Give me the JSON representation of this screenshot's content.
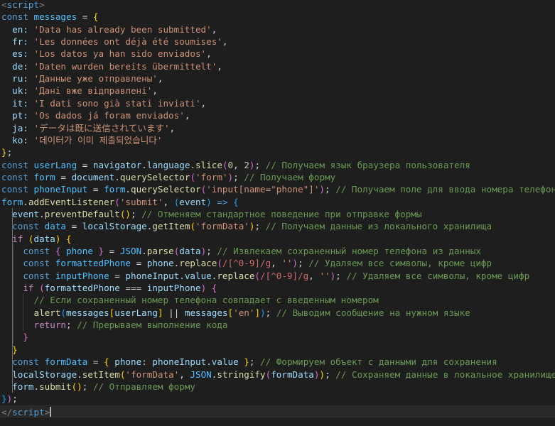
{
  "editor": {
    "language": "javascript",
    "colors": {
      "background": "#1e1e1e",
      "tag": "#569cd6",
      "keyword": "#569cd6",
      "control": "#c586c0",
      "variable": "#9cdcfe",
      "constant": "#4fc1ff",
      "function": "#dcdcaa",
      "string": "#ce9178",
      "number": "#b5cea8",
      "comment": "#6a9955",
      "regex": "#d16969",
      "bracket_gold": "#ffd700",
      "bracket_purple": "#da70d6",
      "bracket_blue": "#179fff",
      "text": "#d4d4d4",
      "punct": "#808080"
    },
    "lines": [
      [
        [
          "<",
          "punct"
        ],
        [
          "script",
          "tag"
        ],
        [
          ">",
          "punct"
        ]
      ],
      [
        [
          "const ",
          "keyword"
        ],
        [
          "messages",
          "constant"
        ],
        [
          " = ",
          "text"
        ],
        [
          "{",
          "bracket_gold"
        ]
      ],
      [
        [
          "  en: ",
          "variable"
        ],
        [
          "'Data has already been submitted'",
          "string"
        ],
        [
          ",",
          "text"
        ]
      ],
      [
        [
          "  fr: ",
          "variable"
        ],
        [
          "'Les données ont déjà été soumises'",
          "string"
        ],
        [
          ",",
          "text"
        ]
      ],
      [
        [
          "  es: ",
          "variable"
        ],
        [
          "'Los datos ya han sido enviados'",
          "string"
        ],
        [
          ",",
          "text"
        ]
      ],
      [
        [
          "  de: ",
          "variable"
        ],
        [
          "'Daten wurden bereits übermittelt'",
          "string"
        ],
        [
          ",",
          "text"
        ]
      ],
      [
        [
          "  ru: ",
          "variable"
        ],
        [
          "'Данные уже отправлены'",
          "string"
        ],
        [
          ",",
          "text"
        ]
      ],
      [
        [
          "  uk: ",
          "variable"
        ],
        [
          "'Дані вже відправлені'",
          "string"
        ],
        [
          ",",
          "text"
        ]
      ],
      [
        [
          "  it: ",
          "variable"
        ],
        [
          "'I dati sono già stati inviati'",
          "string"
        ],
        [
          ",",
          "text"
        ]
      ],
      [
        [
          "  pt: ",
          "variable"
        ],
        [
          "'Os dados já foram enviados'",
          "string"
        ],
        [
          ",",
          "text"
        ]
      ],
      [
        [
          "  ja: ",
          "variable"
        ],
        [
          "'データは既に送信されています'",
          "string"
        ],
        [
          ",",
          "text"
        ]
      ],
      [
        [
          "  ko: ",
          "variable"
        ],
        [
          "'데이터가 이미 제출되었습니다'",
          "string"
        ]
      ],
      [
        [
          "}",
          "bracket_gold"
        ],
        [
          ";",
          "text"
        ]
      ],
      [
        [
          "const ",
          "keyword"
        ],
        [
          "userLang",
          "constant"
        ],
        [
          " = ",
          "text"
        ],
        [
          "navigator",
          "variable"
        ],
        [
          ".",
          "text"
        ],
        [
          "language",
          "variable"
        ],
        [
          ".",
          "text"
        ],
        [
          "slice",
          "function"
        ],
        [
          "(",
          "bracket_purple"
        ],
        [
          "0",
          "number"
        ],
        [
          ", ",
          "text"
        ],
        [
          "2",
          "number"
        ],
        [
          ")",
          "bracket_purple"
        ],
        [
          "; ",
          "text"
        ],
        [
          "// Получаем язык браузера пользователя",
          "comment"
        ]
      ],
      [
        [
          "const ",
          "keyword"
        ],
        [
          "form",
          "constant"
        ],
        [
          " = ",
          "text"
        ],
        [
          "document",
          "variable"
        ],
        [
          ".",
          "text"
        ],
        [
          "querySelector",
          "function"
        ],
        [
          "(",
          "bracket_purple"
        ],
        [
          "'form'",
          "string"
        ],
        [
          ")",
          "bracket_purple"
        ],
        [
          "; ",
          "text"
        ],
        [
          "// Получаем форму",
          "comment"
        ]
      ],
      [
        [
          "const ",
          "keyword"
        ],
        [
          "phoneInput",
          "constant"
        ],
        [
          " = ",
          "text"
        ],
        [
          "form",
          "constant"
        ],
        [
          ".",
          "text"
        ],
        [
          "querySelector",
          "function"
        ],
        [
          "(",
          "bracket_purple"
        ],
        [
          "'input[name=\"phone\"]'",
          "string"
        ],
        [
          ")",
          "bracket_purple"
        ],
        [
          "; ",
          "text"
        ],
        [
          "// Получаем поле для ввода номера телефона",
          "comment"
        ]
      ],
      [
        [
          "form",
          "constant"
        ],
        [
          ".",
          "text"
        ],
        [
          "addEventListener",
          "function"
        ],
        [
          "(",
          "bracket_purple"
        ],
        [
          "'submit'",
          "string"
        ],
        [
          ", ",
          "text"
        ],
        [
          "(",
          "bracket_blue"
        ],
        [
          "event",
          "variable"
        ],
        [
          ")",
          "bracket_blue"
        ],
        [
          " => ",
          "keyword"
        ],
        [
          "{",
          "bracket_blue"
        ]
      ],
      [
        [
          "  event",
          "variable"
        ],
        [
          ".",
          "text"
        ],
        [
          "preventDefault",
          "function"
        ],
        [
          "()",
          "bracket_gold"
        ],
        [
          "; ",
          "text"
        ],
        [
          "// Отменяем стандартное поведение при отправке формы",
          "comment"
        ]
      ],
      [
        [
          "  const ",
          "keyword"
        ],
        [
          "data",
          "constant"
        ],
        [
          " = ",
          "text"
        ],
        [
          "localStorage",
          "variable"
        ],
        [
          ".",
          "text"
        ],
        [
          "getItem",
          "function"
        ],
        [
          "(",
          "bracket_gold"
        ],
        [
          "'formData'",
          "string"
        ],
        [
          ")",
          "bracket_gold"
        ],
        [
          "; ",
          "text"
        ],
        [
          "// Получаем данные из локального хранилища",
          "comment"
        ]
      ],
      [
        [
          "  if ",
          "control"
        ],
        [
          "(",
          "bracket_gold"
        ],
        [
          "data",
          "variable"
        ],
        [
          ") ",
          "bracket_gold"
        ],
        [
          "{",
          "bracket_gold"
        ]
      ],
      [
        [
          "    const ",
          "keyword"
        ],
        [
          "{ ",
          "bracket_purple"
        ],
        [
          "phone",
          "constant"
        ],
        [
          " }",
          "bracket_purple"
        ],
        [
          " = ",
          "text"
        ],
        [
          "JSON",
          "constant"
        ],
        [
          ".",
          "text"
        ],
        [
          "parse",
          "function"
        ],
        [
          "(",
          "bracket_purple"
        ],
        [
          "data",
          "variable"
        ],
        [
          ")",
          "bracket_purple"
        ],
        [
          "; ",
          "text"
        ],
        [
          "// Извлекаем сохраненный номер телефона из данных",
          "comment"
        ]
      ],
      [
        [
          "    const ",
          "keyword"
        ],
        [
          "formattedPhone",
          "constant"
        ],
        [
          " = ",
          "text"
        ],
        [
          "phone",
          "variable"
        ],
        [
          ".",
          "text"
        ],
        [
          "replace",
          "function"
        ],
        [
          "(",
          "bracket_purple"
        ],
        [
          "/[^0-9]/g",
          "regex"
        ],
        [
          ", ",
          "text"
        ],
        [
          "''",
          "string"
        ],
        [
          ")",
          "bracket_purple"
        ],
        [
          "; ",
          "text"
        ],
        [
          "// Удаляем все символы, кроме цифр",
          "comment"
        ]
      ],
      [
        [
          "    const ",
          "keyword"
        ],
        [
          "inputPhone",
          "constant"
        ],
        [
          " = ",
          "text"
        ],
        [
          "phoneInput",
          "variable"
        ],
        [
          ".",
          "text"
        ],
        [
          "value",
          "variable"
        ],
        [
          ".",
          "text"
        ],
        [
          "replace",
          "function"
        ],
        [
          "(",
          "bracket_purple"
        ],
        [
          "/[^0-9]/g",
          "regex"
        ],
        [
          ", ",
          "text"
        ],
        [
          "''",
          "string"
        ],
        [
          ")",
          "bracket_purple"
        ],
        [
          "; ",
          "text"
        ],
        [
          "// Удаляем все символы, кроме цифр",
          "comment"
        ]
      ],
      [
        [
          "    if ",
          "control"
        ],
        [
          "(",
          "bracket_purple"
        ],
        [
          "formattedPhone",
          "variable"
        ],
        [
          " === ",
          "text"
        ],
        [
          "inputPhone",
          "variable"
        ],
        [
          ")",
          "bracket_purple"
        ],
        [
          " ",
          "text"
        ],
        [
          "{",
          "bracket_purple"
        ]
      ],
      [
        [
          "      // Если сохраненный номер телефона совпадает с введенным номером",
          "comment"
        ]
      ],
      [
        [
          "      alert",
          "function"
        ],
        [
          "(",
          "bracket_blue"
        ],
        [
          "messages",
          "variable"
        ],
        [
          "[",
          "bracket_gold"
        ],
        [
          "userLang",
          "variable"
        ],
        [
          "]",
          "bracket_gold"
        ],
        [
          " || ",
          "text"
        ],
        [
          "messages",
          "variable"
        ],
        [
          "[",
          "bracket_gold"
        ],
        [
          "'en'",
          "string"
        ],
        [
          "]",
          "bracket_gold"
        ],
        [
          ")",
          "bracket_blue"
        ],
        [
          "; ",
          "text"
        ],
        [
          "// Выводим сообщение на нужном языке",
          "comment"
        ]
      ],
      [
        [
          "      return",
          "control"
        ],
        [
          "; ",
          "text"
        ],
        [
          "// Прерываем выполнение кода",
          "comment"
        ]
      ],
      [
        [
          "    }",
          "bracket_purple"
        ]
      ],
      [
        [
          "  }",
          "bracket_gold"
        ]
      ],
      [
        [
          "  const ",
          "keyword"
        ],
        [
          "formData",
          "constant"
        ],
        [
          " = ",
          "text"
        ],
        [
          "{ ",
          "bracket_gold"
        ],
        [
          "phone",
          "variable"
        ],
        [
          ": ",
          "text"
        ],
        [
          "phoneInput",
          "variable"
        ],
        [
          ".",
          "text"
        ],
        [
          "value",
          "variable"
        ],
        [
          " }",
          "bracket_gold"
        ],
        [
          "; ",
          "text"
        ],
        [
          "// Формируем объект с данными для сохранения",
          "comment"
        ]
      ],
      [
        [
          "  localStorage",
          "variable"
        ],
        [
          ".",
          "text"
        ],
        [
          "setItem",
          "function"
        ],
        [
          "(",
          "bracket_gold"
        ],
        [
          "'formData'",
          "string"
        ],
        [
          ", ",
          "text"
        ],
        [
          "JSON",
          "constant"
        ],
        [
          ".",
          "text"
        ],
        [
          "stringify",
          "function"
        ],
        [
          "(",
          "bracket_purple"
        ],
        [
          "formData",
          "variable"
        ],
        [
          ")",
          "bracket_purple"
        ],
        [
          ")",
          "bracket_gold"
        ],
        [
          "; ",
          "text"
        ],
        [
          "// Сохраняем данные в локальное хранилище",
          "comment"
        ]
      ],
      [
        [
          "  form",
          "variable"
        ],
        [
          ".",
          "text"
        ],
        [
          "submit",
          "function"
        ],
        [
          "()",
          "bracket_gold"
        ],
        [
          "; ",
          "text"
        ],
        [
          "// Отправляем форму",
          "comment"
        ]
      ],
      [
        [
          "}",
          "bracket_blue"
        ],
        [
          ")",
          "bracket_purple"
        ],
        [
          ";",
          "text"
        ]
      ],
      [
        [
          "</",
          "punct"
        ],
        [
          "script",
          "tag"
        ],
        [
          ">",
          "punct"
        ]
      ]
    ]
  }
}
